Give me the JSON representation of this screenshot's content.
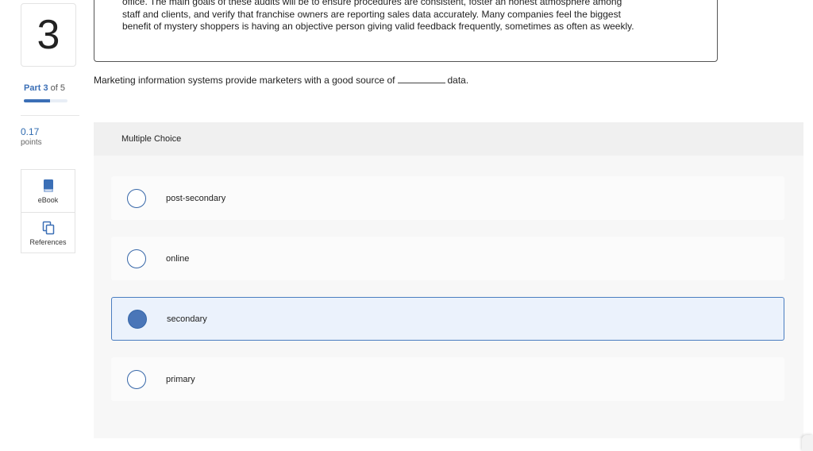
{
  "sidebar": {
    "question_number": "3",
    "part": {
      "label": "Part",
      "current": "3",
      "of_text": "of 5",
      "progress_fraction": 0.6
    },
    "points": {
      "value": "0.17",
      "label": "points"
    },
    "tools": [
      {
        "label": "eBook",
        "icon": "book-icon"
      },
      {
        "label": "References",
        "icon": "copy-icon"
      }
    ]
  },
  "passage": {
    "lines": [
      "office. The main goals of these audits will be to ensure procedures are consistent, foster an honest atmosphere among",
      "staff and clients, and verify that franchise owners are reporting sales data accurately. Many companies feel the biggest",
      "benefit of mystery shoppers is having an objective person giving valid feedback frequently, sometimes as often as weekly."
    ]
  },
  "question": {
    "before_blank": "Marketing information systems provide marketers with a good source of",
    "after_blank": "data."
  },
  "multiple_choice": {
    "header": "Multiple Choice",
    "options": [
      {
        "label": "post-secondary",
        "selected": false
      },
      {
        "label": "online",
        "selected": false
      },
      {
        "label": "secondary",
        "selected": true
      },
      {
        "label": "primary",
        "selected": false
      }
    ]
  },
  "colors": {
    "accent": "#3b6fb6",
    "selected_bg": "#ebf2fc",
    "selected_radio": "#4a76b8"
  }
}
